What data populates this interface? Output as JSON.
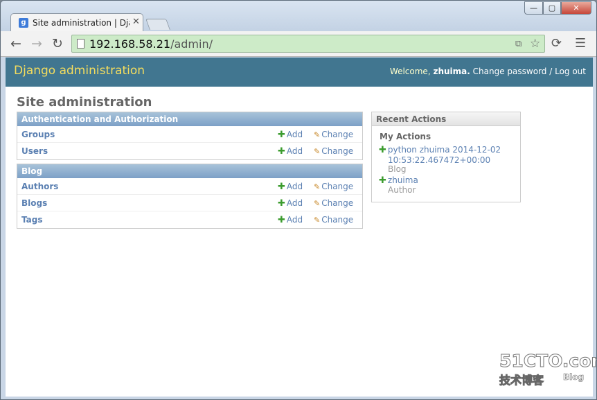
{
  "browser": {
    "tab_title": "Site administration | Dja",
    "tab_favicon": "g",
    "url_host": "192.168.58.21",
    "url_path": "/admin/",
    "icons": {
      "back": "back-arrow-icon",
      "forward": "forward-arrow-icon",
      "reload": "reload-icon",
      "menu": "hamburger-menu-icon",
      "bookmark": "star-icon",
      "translate": "translate-icon",
      "extension": "extension-icon"
    },
    "window_controls": {
      "min": "—",
      "max": "▢",
      "close": "✕"
    }
  },
  "header": {
    "brand": "Django administration",
    "welcome": "Welcome,",
    "username": "zhuima",
    "change_password": "Change password",
    "separator": "/",
    "logout": "Log out"
  },
  "page_title": "Site administration",
  "apps": [
    {
      "caption": "Authentication and Authorization",
      "models": [
        {
          "name": "Groups",
          "add": "Add",
          "change": "Change"
        },
        {
          "name": "Users",
          "add": "Add",
          "change": "Change"
        }
      ]
    },
    {
      "caption": "Blog",
      "models": [
        {
          "name": "Authors",
          "add": "Add",
          "change": "Change"
        },
        {
          "name": "Blogs",
          "add": "Add",
          "change": "Change"
        },
        {
          "name": "Tags",
          "add": "Add",
          "change": "Change"
        }
      ]
    }
  ],
  "recent_actions": {
    "caption": "Recent Actions",
    "heading": "My Actions",
    "items": [
      {
        "line1": "python zhuima 2014-12-02",
        "line2": "10:53:22.467472+00:00",
        "type": "Blog"
      },
      {
        "line1": "zhuima",
        "line2": "",
        "type": "Author"
      }
    ]
  },
  "watermark": {
    "main": "51CTO.com",
    "sub": "技术博客",
    "blog": "Blog"
  },
  "colors": {
    "header_bg": "#417690",
    "brand": "#f5dd5d",
    "link": "#5b80b2",
    "address_bar": "#cdebc8"
  }
}
